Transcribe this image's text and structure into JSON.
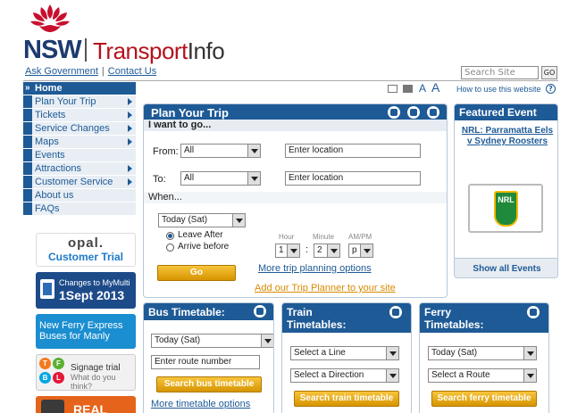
{
  "brand": {
    "nsw": "NSW",
    "transport": "Transport",
    "info": "Info"
  },
  "toplinks": {
    "ask": "Ask Government",
    "sep": "|",
    "contact": "Contact Us"
  },
  "search": {
    "placeholder": "Search Site",
    "go": "GO"
  },
  "nav": {
    "items": [
      "Home",
      "Plan Your Trip",
      "Tickets",
      "Service Changes",
      "Maps",
      "Events",
      "Attractions",
      "Customer Service",
      "About us",
      "FAQs"
    ]
  },
  "promos": {
    "opal": {
      "logo": "opal.",
      "sub": "Customer Trial"
    },
    "mymulti": {
      "line1": "Changes to MyMulti",
      "line2": "1Sept 2013"
    },
    "ferry": {
      "text": "New Ferry Express Buses for Manly"
    },
    "signage": {
      "dots": [
        "T",
        "F",
        "B",
        "L"
      ],
      "line1": "Signage trial",
      "line2": "What do you think?"
    },
    "realtime": {
      "text": "REAL TIME"
    }
  },
  "utils": {
    "a_small": "A",
    "a_large": "A",
    "howto": "How to use this website",
    "help": "?"
  },
  "plan": {
    "title": "Plan Your Trip",
    "want": "I want to go...",
    "from_label": "From:",
    "from_mode": "All",
    "from_loc": "Enter location",
    "to_label": "To:",
    "to_mode": "All",
    "to_loc": "Enter location",
    "when_label": "When...",
    "day": "Today (Sat)",
    "leave": "Leave After",
    "arrive": "Arrive before",
    "hour_label": "Hour",
    "minute_label": "Minute",
    "ampm_label": "AM/PM",
    "hour": "1",
    "colon": ":",
    "minute": "2",
    "ampm": "p",
    "go": "Go",
    "more": "More trip planning options",
    "add": "Add our Trip Planner to your site"
  },
  "featured": {
    "title": "Featured Event",
    "event": "NRL: Parramatta Eels v Sydney Roosters",
    "logo": "NRL",
    "show_all": "Show all Events"
  },
  "bus": {
    "title": "Bus Timetable:",
    "day": "Today (Sat)",
    "route_placeholder": "Enter route number",
    "button": "Search bus timetable",
    "more": "More timetable options"
  },
  "train": {
    "title": "Train Timetables:",
    "line": "Select a Line",
    "direction": "Select a Direction",
    "button": "Search train timetable"
  },
  "ferry": {
    "title": "Ferry Timetables:",
    "day": "Today (Sat)",
    "route": "Select a Route",
    "button": "Search ferry timetable"
  }
}
